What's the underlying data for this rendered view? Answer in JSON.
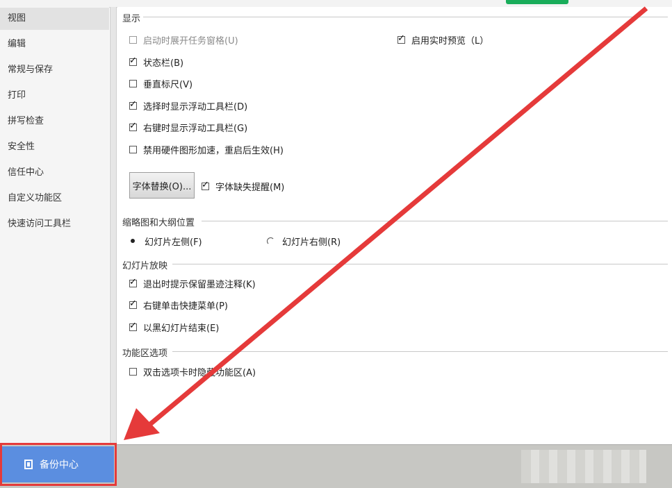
{
  "sidebar": {
    "items": [
      {
        "label": "视图",
        "active": true
      },
      {
        "label": "编辑"
      },
      {
        "label": "常规与保存"
      },
      {
        "label": "打印"
      },
      {
        "label": "拼写检查"
      },
      {
        "label": "安全性"
      },
      {
        "label": "信任中心"
      },
      {
        "label": "自定义功能区"
      },
      {
        "label": "快速访问工具栏"
      }
    ]
  },
  "display": {
    "title": "显示",
    "options": {
      "startup_taskpane": {
        "label": "启动时展开任务窗格(U)",
        "checked": false,
        "disabled": true
      },
      "live_preview": {
        "label": "启用实时预览（L）",
        "checked": true
      },
      "status_bar": {
        "label": "状态栏(B)",
        "checked": true
      },
      "vertical_ruler": {
        "label": "垂直标尺(V)",
        "checked": false
      },
      "float_toolbar_select": {
        "label": "选择时显示浮动工具栏(D)",
        "checked": true
      },
      "float_toolbar_rightclick": {
        "label": "右键时显示浮动工具栏(G)",
        "checked": true
      },
      "disable_hw_accel": {
        "label": "禁用硬件图形加速，重启后生效(H)",
        "checked": false
      },
      "missing_font_alert": {
        "label": "字体缺失提醒(M)",
        "checked": true
      }
    },
    "font_replace_button": "字体替换(O)..."
  },
  "thumbnail": {
    "title": "缩略图和大纲位置",
    "left": {
      "label": "幻灯片左侧(F)",
      "selected": true
    },
    "right": {
      "label": "幻灯片右侧(R)",
      "selected": false
    }
  },
  "slideshow": {
    "title": "幻灯片放映",
    "options": {
      "ink_prompt": {
        "label": "退出时提示保留墨迹注释(K)",
        "checked": true
      },
      "right_click_menu": {
        "label": "右键单击快捷菜单(P)",
        "checked": true
      },
      "end_black": {
        "label": "以黑幻灯片结束(E)",
        "checked": true
      }
    }
  },
  "ribbon": {
    "title": "功能区选项",
    "options": {
      "dblclick_hide": {
        "label": "双击选项卡时隐藏功能区(A)",
        "checked": false
      }
    }
  },
  "footer": {
    "backup_label": "备份中心"
  },
  "colors": {
    "accent_button": "#5b8ee0",
    "annotation_red": "#e53a3a",
    "top_green": "#1aad5b"
  }
}
